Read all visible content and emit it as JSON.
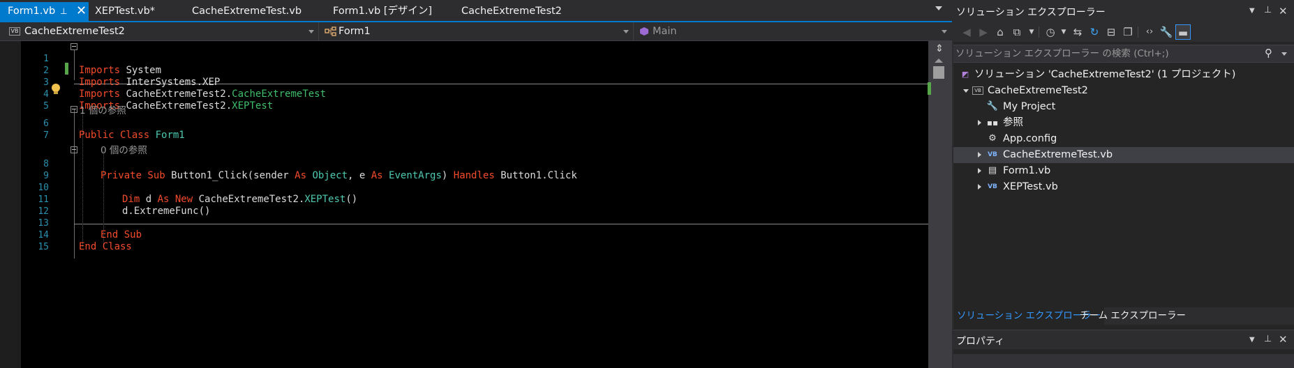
{
  "tabs": [
    {
      "label": "Form1.vb",
      "active": true
    },
    {
      "label": "XEPTest.vb*",
      "active": false
    },
    {
      "label": "CacheExtremeTest.vb",
      "active": false
    },
    {
      "label": "Form1.vb [デザイン]",
      "active": false
    },
    {
      "label": "CacheExtremeTest2",
      "active": false
    }
  ],
  "tab_pin_glyph": "⊥",
  "tab_close_glyph": "✕",
  "nav": {
    "project": "CacheExtremeTest2",
    "class": "Form1",
    "member": "Main",
    "project_badge": "VB"
  },
  "code": {
    "line_numbers": [
      "1",
      "2",
      "3",
      "4",
      "5",
      "6",
      "7",
      "8",
      "9",
      "10",
      "11",
      "12",
      "13",
      "14",
      "15"
    ],
    "l1": {
      "kw": "Imports",
      "rest": " System"
    },
    "l2": {
      "kw": "Imports",
      "rest": " InterSystems.XEP"
    },
    "l3": {
      "kw": "Imports",
      "rest": " CacheExtremeTest2.",
      "type": "CacheExtremeTest"
    },
    "l4": {
      "kw": "Imports",
      "rest": " CacheExtremeTest2.",
      "type": "XEPTest"
    },
    "ref1": "1 個の参照",
    "l6": {
      "kw": "Public Class",
      "name": " Form1"
    },
    "ref2": "0 個の参照",
    "l8": {
      "kw1": "Private Sub",
      "name": " Button1_Click(sender ",
      "as1": "As",
      "t1": " Object",
      "mid": ", e ",
      "as2": "As",
      "t2": " EventArgs",
      "mid2": ") ",
      "handles": "Handles",
      "tail": " Button1.Click"
    },
    "l10": {
      "kw": "Dim",
      "a": " d ",
      "as": "As",
      "new": " New",
      "b": " CacheExtremeTest2.",
      "type": "XEPTest",
      "c": "()"
    },
    "l11": {
      "text": "d.ExtremeFunc()"
    },
    "l13": {
      "kw": "End Sub"
    },
    "l14": {
      "kw": "End Class"
    }
  },
  "solution_explorer": {
    "title": "ソリューション エクスプローラー",
    "search_placeholder": "ソリューション エクスプローラー の検索 (Ctrl+;)",
    "tree": [
      {
        "label": "ソリューション 'CacheExtremeTest2' (1 プロジェクト)",
        "icon": "solution-icon"
      },
      {
        "label": "CacheExtremeTest2",
        "icon": "vb-project-icon"
      },
      {
        "label": "My Project",
        "icon": "wrench-icon"
      },
      {
        "label": "参照",
        "icon": "references-icon"
      },
      {
        "label": "App.config",
        "icon": "config-file-icon"
      },
      {
        "label": "CacheExtremeTest.vb",
        "icon": "vb-file-icon"
      },
      {
        "label": "Form1.vb",
        "icon": "form-file-icon"
      },
      {
        "label": "XEPTest.vb",
        "icon": "vb-file-icon"
      }
    ],
    "bottom_tabs": [
      "ソリューション エクスプローラー",
      "チーム エクスプローラー"
    ]
  },
  "properties": {
    "title": "プロパティ"
  },
  "colors": {
    "accent": "#007acc",
    "keyword": "#f44b2b",
    "type": "#4ec9b0",
    "line_number": "#2b91af",
    "bottom_tab_active": "#3399ff"
  }
}
